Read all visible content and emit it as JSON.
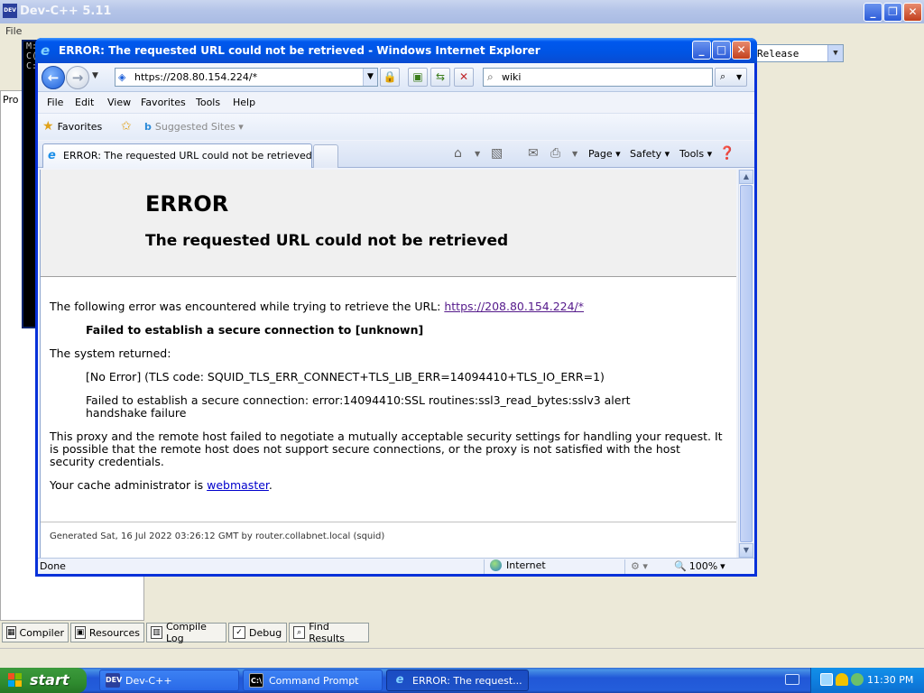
{
  "devcpp": {
    "title": "Dev-C++ 5.11",
    "menu_file": "File",
    "release": "Release",
    "project_tab": "Pro",
    "console_lines": [
      "M:",
      "C(",
      "C:"
    ],
    "bottom_tabs": [
      "Compiler",
      "Resources",
      "Compile Log",
      "Debug",
      "Find Results"
    ]
  },
  "ie": {
    "title": "ERROR: The requested URL could not be retrieved - Windows Internet Explorer",
    "address": "https://208.80.154.224/*",
    "search_value": "wiki",
    "menu": [
      "File",
      "Edit",
      "View",
      "Favorites",
      "Tools",
      "Help"
    ],
    "favorites_label": "Favorites",
    "suggested_sites": "Suggested Sites",
    "tab_title": "ERROR: The requested URL could not be retrieved",
    "commands": {
      "page": "Page",
      "safety": "Safety",
      "tools": "Tools"
    },
    "status": {
      "text": "Done",
      "zone": "Internet",
      "zoom": "100%"
    }
  },
  "page": {
    "h1": "ERROR",
    "h2": "The requested URL could not be retrieved",
    "intro": "The following error was encountered while trying to retrieve the URL: ",
    "url_link": "https://208.80.154.224/*",
    "failed": "Failed to establish a secure connection to [unknown]",
    "system_returned": "The system returned:",
    "no_error": "[No Error] (TLS code: SQUID_TLS_ERR_CONNECT+TLS_LIB_ERR=14094410+TLS_IO_ERR=1)",
    "ssl_error_1": "Failed to establish a secure connection: error:14094410:SSL routines:ssl3_read_bytes:sslv3 alert",
    "ssl_error_2": "handshake failure",
    "proxy_1": "This proxy and the remote host failed to negotiate a mutually acceptable security settings for handling your request. It",
    "proxy_2": "is possible that the remote host does not support secure connections, or the proxy is not satisfied with the host",
    "proxy_3": "security credentials.",
    "admin_pre": "Your cache administrator is ",
    "admin_link": "webmaster",
    "admin_post": ".",
    "generated": "Generated Sat, 16 Jul 2022 03:26:12 GMT by router.collabnet.local (squid)"
  },
  "taskbar": {
    "start": "start",
    "tasks": [
      "Dev-C++",
      "Command Prompt",
      "ERROR: The request..."
    ],
    "clock": "11:30 PM"
  },
  "icons": {
    "back": "back-arrow-icon",
    "forward": "forward-arrow-icon",
    "search": "search-icon",
    "home": "home-icon",
    "feeds": "rss-icon",
    "print": "printer-icon",
    "help": "help-icon"
  }
}
